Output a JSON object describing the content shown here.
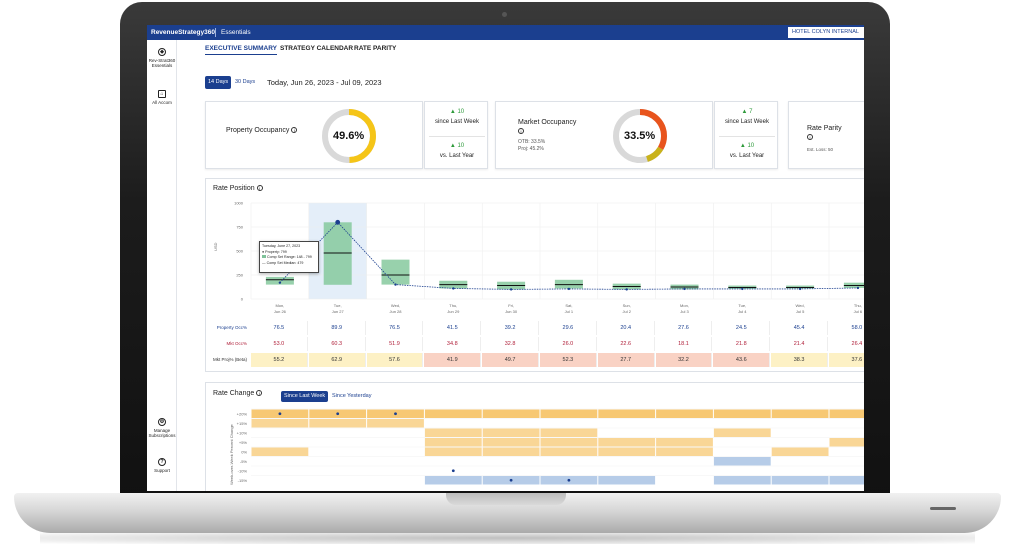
{
  "app": {
    "brand": "RevenueStrategy360",
    "product": "Essentials",
    "hotel": "HOTEL COLYN INTERNAL"
  },
  "sidebar": {
    "items": [
      {
        "label": "Rev-Strat360 Essentials",
        "icon": "compass-icon"
      },
      {
        "label": "All Accom",
        "icon": "home-icon"
      },
      {
        "label": "Manage Subscriptions",
        "icon": "gear-icon"
      },
      {
        "label": "Support",
        "icon": "help-icon"
      }
    ]
  },
  "tabs": [
    "EXECUTIVE SUMMARY",
    "STRATEGY CALENDAR",
    "RATE PARITY"
  ],
  "range": {
    "options": [
      "14 Days",
      "30 Days"
    ],
    "selected": "14 Days",
    "date_label": "Today, Jun 26, 2023 - Jul 09, 2023"
  },
  "kpis": {
    "property_occupancy": {
      "label": "Property Occupancy",
      "value": "49.6%",
      "fill": 0.496,
      "color": "#f5c518"
    },
    "property_deltas": [
      {
        "value": "10",
        "label": "since Last Week"
      },
      {
        "value": "10",
        "label": "vs. Last Year"
      }
    ],
    "market_occupancy": {
      "label": "Market Occupancy",
      "value": "33.5%",
      "otb": "OTB: 33.5%",
      "proj": "Proj: 45.2%",
      "fill": 0.335,
      "color": "#e8541d",
      "proj_fill": 0.452
    },
    "market_deltas": [
      {
        "value": "7",
        "label": "since Last Week"
      },
      {
        "value": "10",
        "label": "vs. Last Year"
      }
    ],
    "rate_parity": {
      "label": "Rate Parity",
      "sub": "Est. Loss: 50"
    }
  },
  "rate_position": {
    "title": "Rate Position",
    "y_axis_label": "USD",
    "y_ticks": [
      "1000",
      "750",
      "500",
      "250",
      "0"
    ],
    "days": [
      {
        "dow": "Mon,",
        "date": "Jun 26"
      },
      {
        "dow": "Tue,",
        "date": "Jun 27"
      },
      {
        "dow": "Wed,",
        "date": "Jun 28"
      },
      {
        "dow": "Thu,",
        "date": "Jun 29"
      },
      {
        "dow": "Fri,",
        "date": "Jun 30"
      },
      {
        "dow": "Sat,",
        "date": "Jul 1"
      },
      {
        "dow": "Sun,",
        "date": "Jul 2"
      },
      {
        "dow": "Mon,",
        "date": "Jul 3"
      },
      {
        "dow": "Tue,",
        "date": "Jul 4"
      },
      {
        "dow": "Wed,",
        "date": "Jul 5"
      },
      {
        "dow": "Thu,",
        "date": "Jul 6"
      }
    ],
    "tooltip": {
      "date": "Tuesday, June 27, 2023",
      "property": "Property: 799",
      "range": "Comp Set Range: 148 - 799",
      "median": "Comp Set Median: 479"
    },
    "rows": [
      {
        "label": "Property Occ%",
        "color": "#1b3f8f",
        "values": [
          "76.5",
          "89.9",
          "76.5",
          "41.5",
          "39.2",
          "29.6",
          "20.4",
          "27.6",
          "24.5",
          "45.4",
          "58.0"
        ]
      },
      {
        "label": "Mkt Occ%",
        "color": "#b0203a",
        "values": [
          "53.0",
          "60.3",
          "51.9",
          "34.8",
          "32.8",
          "26.0",
          "22.6",
          "18.1",
          "21.8",
          "21.4",
          "26.4"
        ]
      },
      {
        "label": "Mkt Proj% (Beta)",
        "color": "#333333",
        "values": [
          "55.2",
          "62.9",
          "57.6",
          "41.9",
          "49.7",
          "52.3",
          "27.7",
          "32.2",
          "43.6",
          "38.3",
          "37.6"
        ]
      }
    ]
  },
  "chart_data": {
    "type": "line",
    "title": "Rate Position",
    "ylabel": "USD",
    "ylim": [
      0,
      1000
    ],
    "categories": [
      "Jun 26",
      "Jun 27",
      "Jun 28",
      "Jun 29",
      "Jun 30",
      "Jul 1",
      "Jul 2",
      "Jul 3",
      "Jul 4",
      "Jul 5",
      "Jul 6"
    ],
    "series": [
      {
        "values": [
          170,
          799,
          150,
          110,
          100,
          105,
          100,
          105,
          105,
          105,
          115
        ]
      }
    ],
    "comp_set_low": [
      150,
      148,
      150,
      110,
      100,
      110,
      100,
      100,
      105,
      110,
      115
    ],
    "comp_set_high": [
      230,
      799,
      410,
      190,
      180,
      200,
      160,
      150,
      140,
      140,
      170
    ],
    "comp_set_median": [
      200,
      479,
      250,
      150,
      140,
      150,
      130,
      125,
      120,
      120,
      140
    ]
  },
  "rate_change": {
    "title": "Rate Change",
    "options": [
      "Since Last Week",
      "Since Yesterday"
    ],
    "selected": "Since Last Week",
    "y_axis_label": "Week-over-Week Percent Change",
    "y_ticks": [
      "+20%",
      "+15%",
      "+10%",
      "+5%",
      "0%",
      "-5%",
      "-10%",
      "-15%"
    ],
    "colors": {
      "increase": "#f7c873",
      "decrease": "#9dbbe0"
    }
  }
}
